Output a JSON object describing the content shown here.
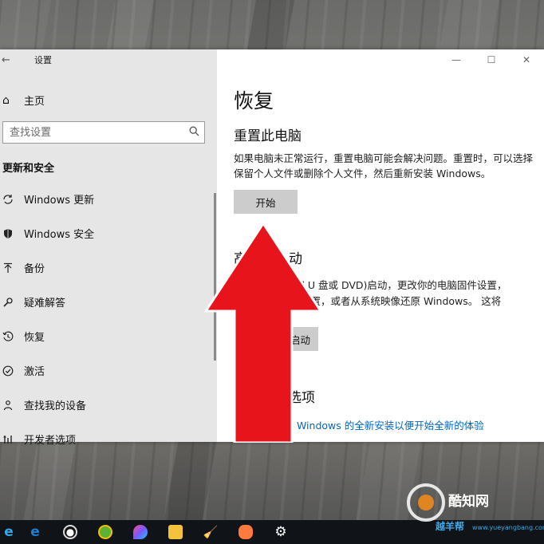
{
  "window": {
    "title": "设置",
    "back_icon": "arrow-left-icon",
    "controls": {
      "minimize": "—",
      "maximize": "☐",
      "close": "✕"
    }
  },
  "sidebar": {
    "home_label": "主页",
    "search_placeholder": "查找设置",
    "section_title": "更新和安全",
    "items": [
      {
        "icon": "sync-icon",
        "label": "Windows 更新"
      },
      {
        "icon": "shield-icon",
        "label": "Windows 安全"
      },
      {
        "icon": "backup-icon",
        "label": "备份"
      },
      {
        "icon": "wrench-icon",
        "label": "疑难解答"
      },
      {
        "icon": "history-icon",
        "label": "恢复"
      },
      {
        "icon": "check-circle-icon",
        "label": "激活"
      },
      {
        "icon": "person-locate-icon",
        "label": "查找我的设备"
      },
      {
        "icon": "developer-icon",
        "label": "开发者选项"
      }
    ]
  },
  "main": {
    "title": "恢复",
    "reset_heading": "重置此电脑",
    "reset_desc": "如果电脑未正常运行，重置电脑可能会解决问题。重置时，可以选择保留个人文件或删除个人文件，然后重新安装 Windows。",
    "reset_button": "开始",
    "advanced_heading_visible": "高",
    "advanced_heading_tail": "动",
    "advanced_desc_line1": "盘(如 U 盘或 DVD)启动，更改你的电脑固件设置，",
    "advanced_desc_line2": "启动设置，或者从系统映像还原 Windows。  这将",
    "advanced_button_visible": "启动",
    "more_heading": "更多恢复选项",
    "link": "了解如何进行 Windows 的全新安装以便开始全新的体验"
  },
  "overlay": {
    "arrow_color": "#e8141c"
  },
  "taskbar": {
    "icons": [
      "ie-icon",
      "edge-icon",
      "qq-icon",
      "browser-360-icon",
      "paint3d-icon",
      "file-explorer-icon",
      "broom-cleaner-icon",
      "painting-icon",
      "gear-icon"
    ]
  },
  "watermark": {
    "brand": "酷知网",
    "site": "www.yueyangbang.com",
    "brand2": "越羊帮"
  }
}
